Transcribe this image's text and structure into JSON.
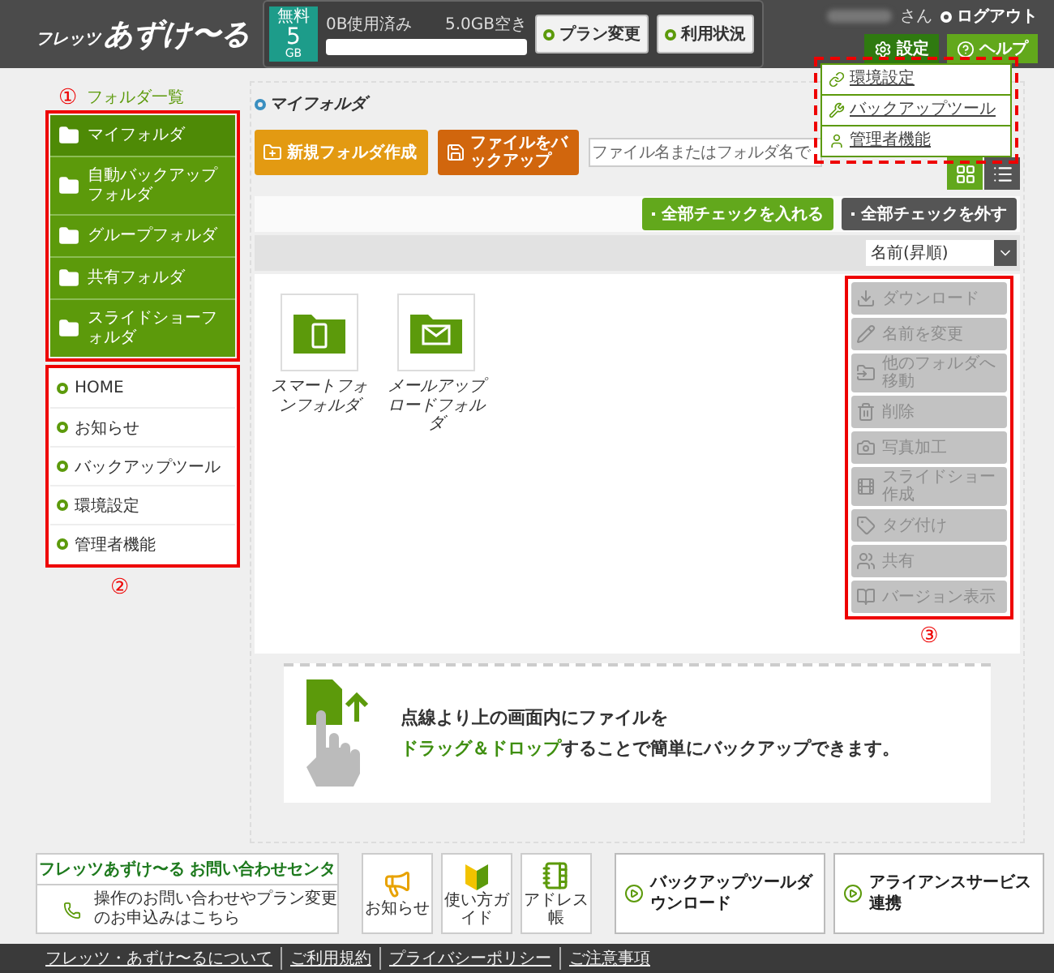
{
  "header": {
    "logo": {
      "small": "フレッツ",
      "large": "あずけ〜る"
    },
    "plan": {
      "label": "無料",
      "size": "5",
      "unit": "GB"
    },
    "usage": {
      "used": "0B使用済み",
      "free": "5.0GB空き",
      "level": 0
    },
    "buttons": [
      "プラン変更",
      "利用状況"
    ],
    "user_suffix": "さん",
    "logout": "ログアウト",
    "settings": "設定",
    "help": "ヘルプ",
    "settings_menu": {
      "expanded": true,
      "items": [
        {
          "label": "環境設定"
        },
        {
          "label": "バックアップツール"
        },
        {
          "label": "管理者機能"
        }
      ]
    }
  },
  "sidebar": {
    "marker": "①",
    "title": "フォルダ一覧",
    "folders": [
      {
        "label": "マイフォルダ",
        "selected": true
      },
      {
        "label": "自動バックアップフォルダ",
        "selected": false
      },
      {
        "label": "グループフォルダ",
        "selected": false
      },
      {
        "label": "共有フォルダ",
        "selected": false
      },
      {
        "label": "スライドショーフォルダ",
        "selected": false
      }
    ],
    "menu": [
      "HOME",
      "お知らせ",
      "バックアップツール",
      "環境設定",
      "管理者機能"
    ],
    "menu_marker": "②"
  },
  "main": {
    "title": "マイフォルダ",
    "actions": [
      "新規フォルダ作成",
      "ファイルをバックアップ"
    ],
    "search": {
      "placeholder": "ファイル名またはフォルダ名で"
    },
    "view_toggles": [
      {
        "selected": true
      },
      {
        "selected": false
      }
    ],
    "check_buttons": [
      {
        "kind": "check",
        "label": "全部チェックを入れる"
      },
      {
        "kind": "uncheck",
        "label": "全部チェックを外す"
      }
    ],
    "sort": "名前(昇順)",
    "folders": [
      {
        "kind": "smartphone",
        "label": "スマートフォンフォルダ"
      },
      {
        "kind": "mail",
        "label": "メールアップロードフォルダ"
      }
    ],
    "file_actions": [
      {
        "label": "ダウンロード",
        "disabled": true
      },
      {
        "label": "名前を変更",
        "disabled": true
      },
      {
        "label": "他のフォルダへ移動",
        "disabled": true
      },
      {
        "label": "削除",
        "disabled": true
      },
      {
        "label": "写真加工",
        "disabled": true
      },
      {
        "label": "スライドショー作成",
        "disabled": true
      },
      {
        "label": "タグ付け",
        "disabled": true
      },
      {
        "label": "共有",
        "disabled": true
      },
      {
        "label": "バージョン表示",
        "disabled": true
      }
    ],
    "file_actions_marker": "③",
    "drop_hint": [
      "点線より上の画面内にファイルを",
      "**ドラッグ＆ドロップ**することで簡単にバックアップできます。"
    ]
  },
  "footer": {
    "contact": {
      "title": "フレッツあずけ〜る お問い合わせセンタ",
      "text": "操作のお問い合わせやプラン変更のお申込みはこちら"
    },
    "tiles": [
      "お知らせ",
      "使い方ガイド",
      "アドレス帳"
    ],
    "big_buttons": [
      "バックアップツールダウンロード",
      "アライアンスサービス連携"
    ],
    "links": [
      "フレッツ・あずけ〜るについて",
      "ご利用規約",
      "プライバシーポリシー",
      "ご注意事項"
    ]
  }
}
